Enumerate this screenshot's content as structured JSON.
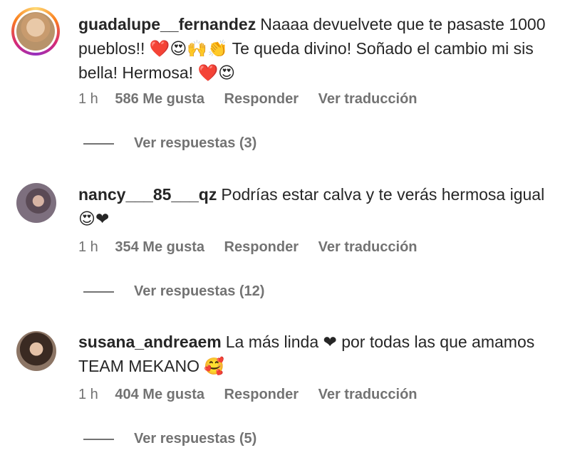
{
  "comments": [
    {
      "username": "guadalupe__fernandez",
      "text": "Naaaa devuelvete que te pasaste 1000 pueblos!! ❤️😍🙌👏 Te queda divino! Soñado el cambio mi sis bella! Hermosa! ❤️😍",
      "time": "1 h",
      "likes": "586 Me gusta",
      "reply": "Responder",
      "translate": "Ver traducción",
      "view_replies": "Ver respuestas (3)"
    },
    {
      "username": "nancy___85___qz",
      "text": "Podrías estar calva y te verás hermosa igual 😍❤",
      "time": "1 h",
      "likes": "354 Me gusta",
      "reply": "Responder",
      "translate": "Ver traducción",
      "view_replies": "Ver respuestas (12)"
    },
    {
      "username": "susana_andreaem",
      "text": "La más linda ❤ por todas las que amamos TEAM MEKANO 🥰",
      "time": "1 h",
      "likes": "404 Me gusta",
      "reply": "Responder",
      "translate": "Ver traducción",
      "view_replies": "Ver respuestas (5)"
    }
  ]
}
